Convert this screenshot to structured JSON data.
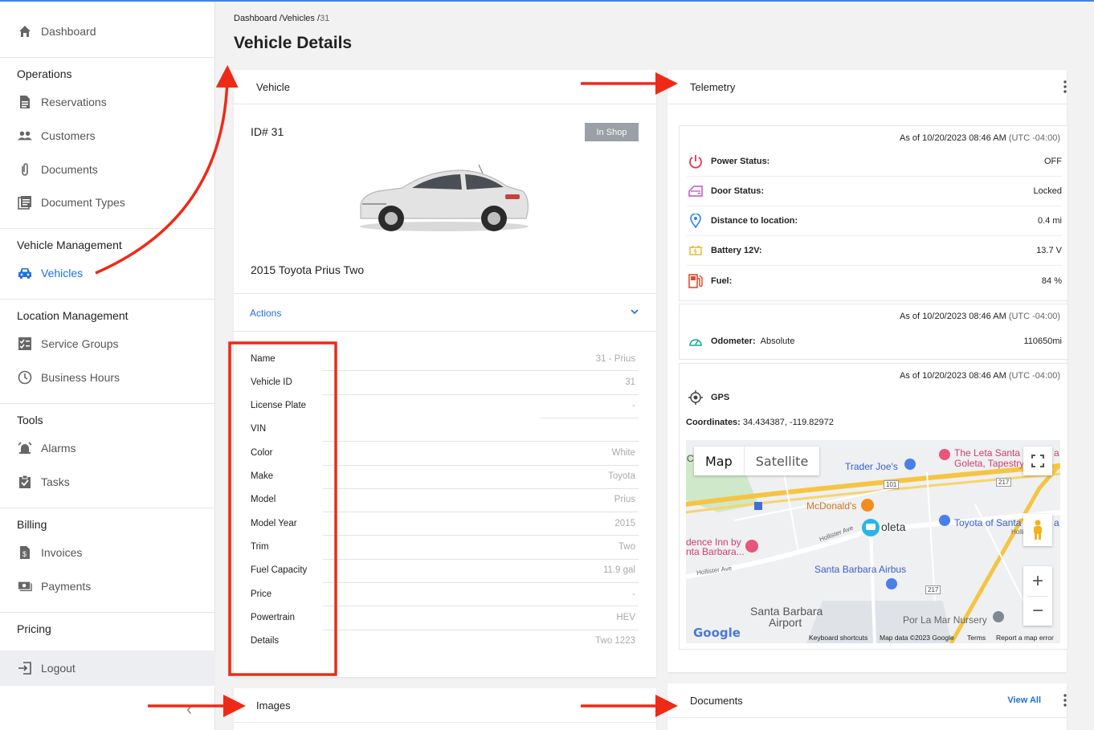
{
  "sidebar": {
    "dashboard": "Dashboard",
    "sections": {
      "operations": "Operations",
      "vehicle_management": "Vehicle Management",
      "location_management": "Location Management",
      "tools": "Tools",
      "billing": "Billing",
      "pricing": "Pricing"
    },
    "items": {
      "reservations": "Reservations",
      "customers": "Customers",
      "documents": "Documents",
      "document_types": "Document Types",
      "vehicles": "Vehicles",
      "service_groups": "Service Groups",
      "business_hours": "Business Hours",
      "alarms": "Alarms",
      "tasks": "Tasks",
      "invoices": "Invoices",
      "payments": "Payments"
    },
    "logout": "Logout",
    "collapse_glyph": "‹"
  },
  "breadcrumb": {
    "dashboard": "Dashboard",
    "sep": "/",
    "vehicles": "Vehicles",
    "current": "31"
  },
  "page_title": "Vehicle Details",
  "vehicle_card": {
    "title": "Vehicle",
    "id_label": "ID# 31",
    "status_badge": "In Shop",
    "vehicle_name": "2015 Toyota Prius Two",
    "actions_label": "Actions",
    "details": [
      {
        "key": "Name",
        "value": "31 - Prius"
      },
      {
        "key": "Vehicle ID",
        "value": "31"
      },
      {
        "key": "License Plate",
        "value": "-"
      },
      {
        "key": "VIN",
        "value": ""
      },
      {
        "key": "Color",
        "value": "White"
      },
      {
        "key": "Make",
        "value": "Toyota"
      },
      {
        "key": "Model",
        "value": "Prius"
      },
      {
        "key": "Model Year",
        "value": "2015"
      },
      {
        "key": "Trim",
        "value": "Two"
      },
      {
        "key": "Fuel Capacity",
        "value": "11.9 gal"
      },
      {
        "key": "Price",
        "value": "-"
      },
      {
        "key": "Powertrain",
        "value": "HEV"
      },
      {
        "key": "Details",
        "value": "Two 1223"
      }
    ]
  },
  "telemetry": {
    "title": "Telemetry",
    "asof_prefix": "As of 10/20/2023 08:46 AM",
    "asof_tz": "(UTC -04:00)",
    "rows": [
      {
        "key": "Power Status:",
        "value": "OFF"
      },
      {
        "key": "Door Status:",
        "value": "Locked"
      },
      {
        "key": "Distance to location:",
        "value": "0.4 mi"
      },
      {
        "key": "Battery 12V:",
        "value": "13.7 V"
      },
      {
        "key": "Fuel:",
        "value": "84 %"
      }
    ],
    "odometer_label": "Odometer:",
    "odometer_type": "Absolute",
    "odometer_value": "110650mi",
    "gps_label": "GPS",
    "coordinates_label": "Coordinates:",
    "coordinates_value": "34.434387, -119.82972",
    "map": {
      "tab_map": "Map",
      "tab_satellite": "Satellite",
      "zoom_in": "+",
      "zoom_out": "−",
      "labels": {
        "trader_joes": "Trader Joe's",
        "leta": "The Leta Santa",
        "goleta_tapestry": "Goleta, Tapestry",
        "mcdonalds": "McDonald's",
        "goleta": "oleta",
        "toyota": "Toyota of Santa",
        "residence1": "dence Inn by",
        "residence2": "nta Barbara...",
        "hollister1": "Hollister Ave",
        "hollister2": "Hollister Ave",
        "hollister3": "Holliste",
        "airbus": "Santa Barbara Airbus",
        "airport1": "Santa Barbara",
        "airport2": "Airport",
        "nursery": "Por La Mar Nursery",
        "r101": "101",
        "r217a": "217",
        "r217b": "217",
        "edge_a": "a",
        "edge_c": "C"
      },
      "google": "Google",
      "footer": {
        "shortcuts": "Keyboard shortcuts",
        "mapdata": "Map data ©2023 Google",
        "terms": "Terms",
        "report": "Report a map error"
      }
    }
  },
  "images_card": {
    "title": "Images"
  },
  "documents_card": {
    "title": "Documents",
    "view_all": "View All"
  },
  "colors": {
    "accent": "#1e6fd9",
    "annotation": "#ee2a17",
    "badge": "#9aa0a6"
  }
}
